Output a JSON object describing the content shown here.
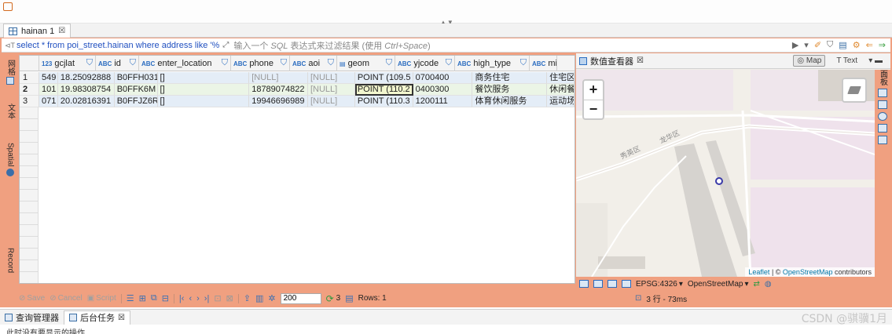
{
  "editor": {
    "tab_label": "hainan 1",
    "tab_close": "☒"
  },
  "filter": {
    "sql_icon": "⊲T",
    "query": "select * from poi_street.hainan where address like '%",
    "hint_prefix": "输入一个 ",
    "hint_sql": "SQL",
    "hint_mid": " 表达式来过滤结果 (使用 ",
    "hint_key": "Ctrl+Space",
    "hint_suffix": ")"
  },
  "left_rail": {
    "grid_label": "网格",
    "text_label": "文本",
    "spatial_label": "Spatial",
    "record_label": "Record"
  },
  "grid": {
    "columns": [
      {
        "type": "",
        "label": "",
        "width": 25
      },
      {
        "type": "123",
        "label": "gcjlat",
        "width": 72
      },
      {
        "type": "ABC",
        "label": "id",
        "width": 55
      },
      {
        "type": "ABC",
        "label": "enter_location",
        "width": 117
      },
      {
        "type": "ABC",
        "label": "phone",
        "width": 75
      },
      {
        "type": "ABC",
        "label": "aoi",
        "width": 60
      },
      {
        "type": "▤",
        "label": "geom",
        "width": 74
      },
      {
        "type": "ABC",
        "label": "yjcode",
        "width": 76
      },
      {
        "type": "ABC",
        "label": "high_type",
        "width": 95
      },
      {
        "type": "ABC",
        "label": "mi",
        "width": 35
      }
    ],
    "rows": [
      {
        "num": "1",
        "cells": [
          "549",
          "18.25092888",
          "B0FFH031",
          "[]",
          "[NULL]",
          "[NULL]",
          "POINT (109.5",
          "0700400",
          "商务住宅",
          "住宅区"
        ]
      },
      {
        "num": "2",
        "cells": [
          "101",
          "19.98308754",
          "B0FFK6M",
          "[]",
          "18789074822",
          "[NULL]",
          "POINT (110.2",
          "0400300",
          "餐饮服务",
          "休闲餐"
        ]
      },
      {
        "num": "3",
        "cells": [
          "071",
          "20.02816391",
          "B0FFJZ6R",
          "[]",
          "19946696989",
          "[NULL]",
          "POINT (110.3",
          "1200111",
          "体育休闲服务",
          "运动场"
        ]
      }
    ]
  },
  "map_viewer": {
    "title": "数值查看器",
    "mode_map": "Map",
    "mode_text": "Text",
    "zoom_in": "+",
    "zoom_out": "−",
    "attribution_leaflet": "Leaflet",
    "attribution_sep": " | © ",
    "attribution_osm": "OpenStreetMap",
    "attribution_tail": " contributors",
    "label_road_a": "秀英区",
    "label_road_b": "龙华区",
    "right_rail_label": "面板",
    "crs": "EPSG:4326",
    "basemap": "OpenStreetMap"
  },
  "toolbar": {
    "save": "Save",
    "cancel": "Cancel",
    "script": "Script",
    "fetch_size": "200",
    "fetch_count": "3",
    "rows_label": "Rows: 1",
    "status": "3 行 - 73ms"
  },
  "bottom": {
    "tab_query_manager": "查询管理器",
    "tab_background": "后台任务",
    "message": "此时没有要显示的操作",
    "watermark": "CSDN @骐骥1月"
  },
  "colors": {
    "frame": "#f0a080",
    "sql_text": "#2050c0",
    "row_blue": "#e4edf7",
    "row_green": "#ebf5e6"
  }
}
